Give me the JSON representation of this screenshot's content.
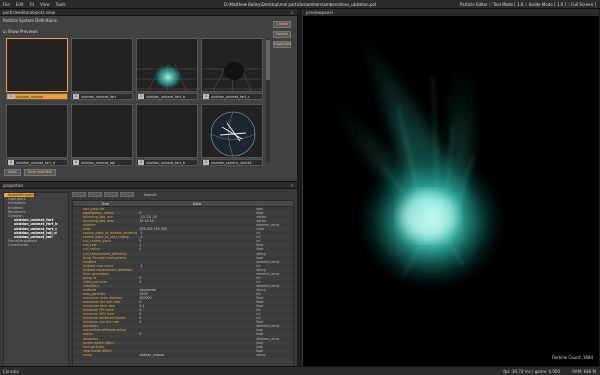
{
  "app": {
    "title": "D:\\Matthew Bailey\\Desktop\\real particles\\ambers\\ambers\\lines_ukdddan.pof",
    "mode": "Particle Editor :: Tool Mode [ 1.0 :: Inside Mode [ 1.0 ] :: Full Screen ]"
  },
  "menu": [
    "File",
    "Edit",
    "Fit",
    "View",
    "Tools"
  ],
  "previews": {
    "header": "particleeditorobjeckt.view",
    "definitions_label": "Particle System Definitions:",
    "show_previews": "Show Previews",
    "side_buttons": [
      "Create",
      "Delete",
      "Duplicate"
    ],
    "bottom_buttons": [
      "Save",
      "Save and Test"
    ],
    "tiles": [
      {
        "n": "1",
        "label": "ukddan_unbeat",
        "selected": true,
        "art": "empty"
      },
      {
        "n": "1",
        "label": "ukddan_unbeat_fart",
        "selected": false,
        "art": "empty"
      },
      {
        "n": "1",
        "label": "ukddan_unbeat_fart_b",
        "selected": false,
        "art": "glow"
      },
      {
        "n": "1",
        "label": "ukddan_unbeat_fart_c",
        "selected": false,
        "art": "smoke"
      },
      {
        "n": "1",
        "label": "ukddan_unbeat_fart_d",
        "selected": false,
        "art": "empty"
      },
      {
        "n": "1",
        "label": "ukddan_unbeat_tail",
        "selected": false,
        "art": "empty"
      },
      {
        "n": "1",
        "label": "ukddan_unbeat_fart_b",
        "selected": false,
        "art": "empty"
      },
      {
        "n": "1",
        "label": "ukddan_spheric_stackk",
        "selected": false,
        "art": "sphere"
      }
    ]
  },
  "properties": {
    "header": "properties",
    "tree": [
      {
        "label": "SystemProperties",
        "sel": true,
        "bold": false
      },
      {
        "label": "Operators",
        "sel": false,
        "bold": false
      },
      {
        "label": "Initializers",
        "sel": false,
        "bold": false
      },
      {
        "label": "Emitters",
        "sel": false,
        "bold": false
      },
      {
        "label": "Renderers",
        "sel": false,
        "bold": false
      },
      {
        "label": "Children",
        "sel": false,
        "bold": false
      },
      {
        "label": "ukddan_unbeat_fart",
        "sel": false,
        "bold": true
      },
      {
        "label": "ukddan_unbeat_fart_b",
        "sel": false,
        "bold": true
      },
      {
        "label": "ukddan_unbeat_fart_c",
        "sel": false,
        "bold": true
      },
      {
        "label": "ukddan_unbeat_tail_d",
        "sel": false,
        "bold": true
      },
      {
        "label": "ukddan_unbeat_tail",
        "sel": false,
        "bold": true
      },
      {
        "label": "ForceGenerators",
        "sel": false,
        "bold": false
      },
      {
        "label": "Constraints",
        "sel": false,
        "bold": false
      }
    ],
    "search_label": "Search:",
    "columns": [
      "Tree",
      "Data",
      ""
    ],
    "rows": [
      {
        "name": "sort_particles",
        "value": "",
        "type": "bool"
      },
      {
        "name": "aggregation_radius",
        "value": "0",
        "type": "float"
      },
      {
        "name": "bounding_box_min",
        "value": "-10 -10 -10",
        "type": "vector"
      },
      {
        "name": "bounding_box_max",
        "value": "10 10 10",
        "type": "vector"
      },
      {
        "name": "children",
        "value": "",
        "type": "element_array"
      },
      {
        "name": "color",
        "value": "255 255 255 255",
        "type": "color"
      },
      {
        "name": "control_point_to_disable_rendering",
        "value": "-1",
        "type": "int"
      },
      {
        "name": "control_point_to_skip_culling",
        "value": "-1",
        "type": "int"
      },
      {
        "name": "cull_control_point",
        "value": "0",
        "type": "int"
      },
      {
        "name": "cull_cost",
        "value": "1",
        "type": "float"
      },
      {
        "name": "cull_radius",
        "value": "0",
        "type": "float"
      },
      {
        "name": "cull_replacement_definition",
        "value": "",
        "type": "string"
      },
      {
        "name": "Draw Through Leafsystems",
        "value": "",
        "type": "bool"
      },
      {
        "name": "emitters",
        "value": "",
        "type": "element_array"
      },
      {
        "name": "fallback max count",
        "value": "-1",
        "type": "int"
      },
      {
        "name": "fallback replacement definition",
        "value": "",
        "type": "string"
      },
      {
        "name": "force generators",
        "value": "",
        "type": "element_array"
      },
      {
        "name": "group id",
        "value": "0",
        "type": "int"
      },
      {
        "name": "initial_particles",
        "value": "0",
        "type": "int"
      },
      {
        "name": "initializers",
        "value": "",
        "type": "element_array"
      },
      {
        "name": "material",
        "value": "vgui/white",
        "type": "string"
      },
      {
        "name": "max_particles",
        "value": "1000",
        "type": "int"
      },
      {
        "name": "maximum draw distance",
        "value": "100000",
        "type": "float"
      },
      {
        "name": "maximum sim tick rate",
        "value": "0",
        "type": "float"
      },
      {
        "name": "maximum time step",
        "value": "0.1",
        "type": "float"
      },
      {
        "name": "minimum CPU level",
        "value": "0",
        "type": "int"
      },
      {
        "name": "minimum GPU level",
        "value": "0",
        "type": "int"
      },
      {
        "name": "minimum rendered frames",
        "value": "0",
        "type": "int"
      },
      {
        "name": "minimum sim tick rate",
        "value": "0",
        "type": "float"
      },
      {
        "name": "operators",
        "value": "",
        "type": "element_array"
      },
      {
        "name": "preventNameBasedLookup",
        "value": "",
        "type": "bool"
      },
      {
        "name": "radius",
        "value": "5",
        "type": "float"
      },
      {
        "name": "renderers",
        "value": "",
        "type": "element_array"
      },
      {
        "name": "screen space effect",
        "value": "",
        "type": "bool"
      },
      {
        "name": "Sort particles",
        "value": "",
        "type": "bool"
      },
      {
        "name": "view model effect",
        "value": "",
        "type": "bool"
      },
      {
        "name": "name",
        "value": "ukddan_unbeat",
        "type": "string"
      }
    ]
  },
  "viewport": {
    "header": "previewpanel",
    "particle_count": "Particle Count:  1684"
  },
  "status": {
    "label": "Console",
    "fps": "fps: 30.74 ms / game: 0.000",
    "ram": "RAM: 646 M"
  }
}
